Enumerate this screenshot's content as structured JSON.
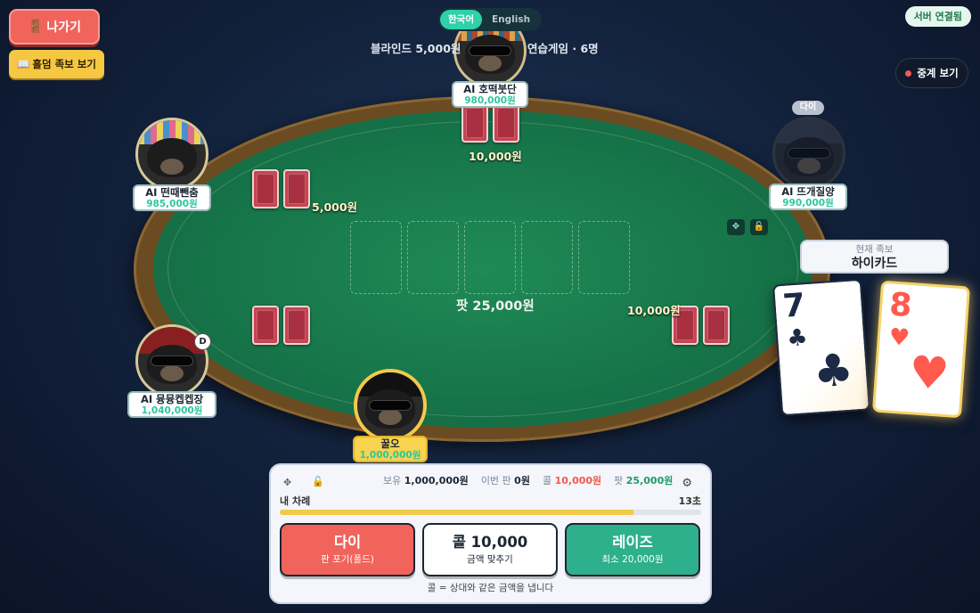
{
  "top": {
    "exit_label": "나가기",
    "exit_icon": "door-icon",
    "guide_label": "홀덤 족보 보기",
    "guide_icon": "book-icon",
    "lang_ko": "한국어",
    "lang_en": "English",
    "blinds": "블라인드 5,000원",
    "mode": "연습게임 · 6명",
    "server_status": "서버 연결됨",
    "spectate_label": "중계 보기"
  },
  "table": {
    "pot": "팟 25,000원",
    "bets": {
      "top": "10,000원",
      "left": "5,000원",
      "right": "10,000원"
    },
    "community_slots": 5
  },
  "players": {
    "top": {
      "name": "AI 호떡붓단",
      "chips": "980,000원"
    },
    "upper_left": {
      "name": "AI 떤때뺀춤",
      "chips": "985,000원"
    },
    "upper_right": {
      "name": "AI 뜨개질양",
      "chips": "990,000원",
      "status": "다이"
    },
    "lower_left": {
      "name": "AI 뮹뮹켑켑장",
      "chips": "1,040,000원",
      "dealer": "D"
    },
    "me": {
      "name": "꿀오",
      "chips": "1,000,000원"
    }
  },
  "hand": {
    "label": "현재 족보",
    "value": "하이카드",
    "cards": [
      {
        "rank": "7",
        "suit": "♣",
        "color": "#1c2a46"
      },
      {
        "rank": "8",
        "suit": "♥",
        "color": "#ff5a4d"
      }
    ]
  },
  "panel": {
    "stack_label": "보유",
    "stack_value": "1,000,000원",
    "round_label": "이번 판",
    "round_value": "0원",
    "call_label": "콜",
    "call_value": "10,000원",
    "pot_label": "팟",
    "pot_value": "25,000원",
    "turn_text": "내 차례",
    "timer": "13초",
    "timer_progress": 0.84,
    "fold_title": "다이",
    "fold_sub": "판 포기(폴드)",
    "call_title": "콜 10,000",
    "call_sub": "금액 맞추기",
    "raise_title": "레이즈",
    "raise_sub": "최소 20,000원",
    "hint": "콜 = 상대와 같은 금액을 냅니다"
  },
  "colors": {
    "accent": "#2ed1a8",
    "fold": "#f0645c",
    "raise": "#2eb08c",
    "gold": "#f3c94b"
  }
}
